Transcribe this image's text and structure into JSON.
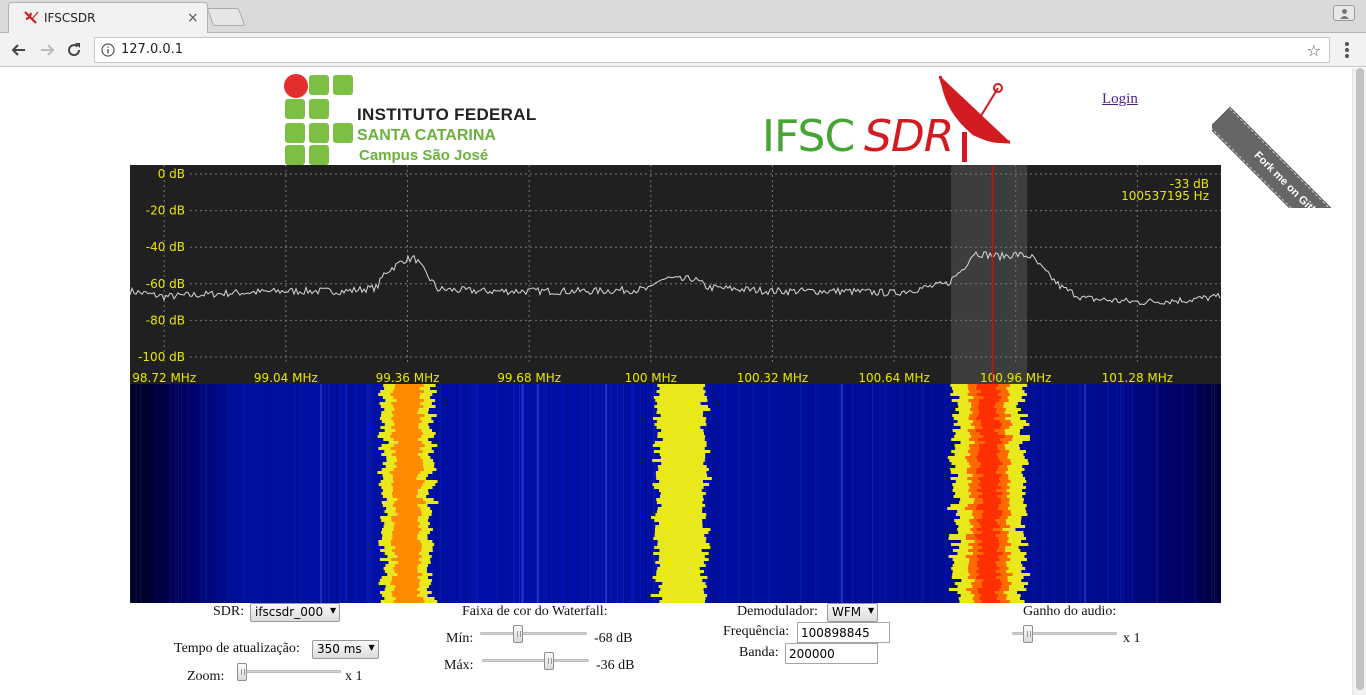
{
  "browser": {
    "tab_title": "IFSCSDR",
    "tab_close": "×",
    "url": "127.0.0.1"
  },
  "header": {
    "ifsc_line1": "INSTITUTO FEDERAL",
    "ifsc_line2": "SANTA CATARINA",
    "ifsc_line3": "Campus São José",
    "sdr_logo_part1": "IFSC",
    "sdr_logo_part2": "SDR",
    "login_label": "Login",
    "github_ribbon": "Fork me on GitHub"
  },
  "chart_data": {
    "type": "line",
    "y_ticks": [
      "0 dB",
      "-20 dB",
      "-40 dB",
      "-60 dB",
      "-80 dB",
      "-100 dB"
    ],
    "ylim": [
      -100,
      0
    ],
    "x_ticks": [
      "98.72 MHz",
      "99.04 MHz",
      "99.36 MHz",
      "99.68 MHz",
      "100 MHz",
      "100.32 MHz",
      "100.64 MHz",
      "100.96 MHz",
      "101.28 MHz"
    ],
    "xlim_mhz": [
      98.63,
      101.5
    ],
    "readout_db": "-33 dB",
    "readout_hz": "100537195 Hz",
    "grid": true,
    "series": [
      {
        "x_mhz": [
          98.63,
          98.72,
          98.9,
          99.04,
          99.2,
          99.28,
          99.3,
          99.33,
          99.35,
          99.38,
          99.4,
          99.44,
          99.55,
          99.68,
          99.85,
          100.0,
          100.02,
          100.05,
          100.08,
          100.11,
          100.15,
          100.32,
          100.5,
          100.64,
          100.78,
          100.82,
          100.85,
          100.88,
          100.92,
          100.96,
          101.0,
          101.04,
          101.08,
          101.14,
          101.28,
          101.4,
          101.5
        ],
        "y_db": [
          -64,
          -67,
          -65,
          -64,
          -64,
          -62,
          -54,
          -50,
          -47,
          -46,
          -52,
          -63,
          -64,
          -64,
          -64,
          -63,
          -58,
          -57,
          -58,
          -57,
          -62,
          -64,
          -64,
          -65,
          -60,
          -52,
          -43,
          -44,
          -45,
          -44,
          -45,
          -54,
          -62,
          -68,
          -70,
          -69,
          -67
        ]
      }
    ],
    "highlight_band_mhz": [
      100.79,
      100.99
    ],
    "marker_mhz": 100.899
  },
  "waterfall": {
    "min_db": -68,
    "max_db": -36,
    "bands_mhz": [
      {
        "center": 99.36,
        "width": 0.13,
        "color": "#ff8a00"
      },
      {
        "center": 100.08,
        "width": 0.13,
        "color": "#e8e81a"
      },
      {
        "center": 100.89,
        "width": 0.18,
        "color": "#ff6a00"
      }
    ]
  },
  "controls": {
    "sdr_label": "SDR:",
    "sdr_value": "ifscsdr_000",
    "update_label": "Tempo de atualização:",
    "update_value": "350 ms",
    "zoom_label": "Zoom:",
    "zoom_value": "x 1",
    "zoom_level": 0.0,
    "waterfall_label": "Faixa de cor do Waterfall:",
    "min_label": "Mín:",
    "min_value": "-68 dB",
    "min_level": 0.34,
    "max_label": "Máx:",
    "max_value": "-36 dB",
    "max_level": 0.64,
    "demod_label": "Demodulador:",
    "demod_value": "WFM",
    "freq_label": "Frequência:",
    "freq_value": "100898845",
    "band_label": "Banda:",
    "band_value": "200000",
    "gain_label": "Ganho do audio:",
    "gain_value": "x 1",
    "gain_level": 0.12
  }
}
